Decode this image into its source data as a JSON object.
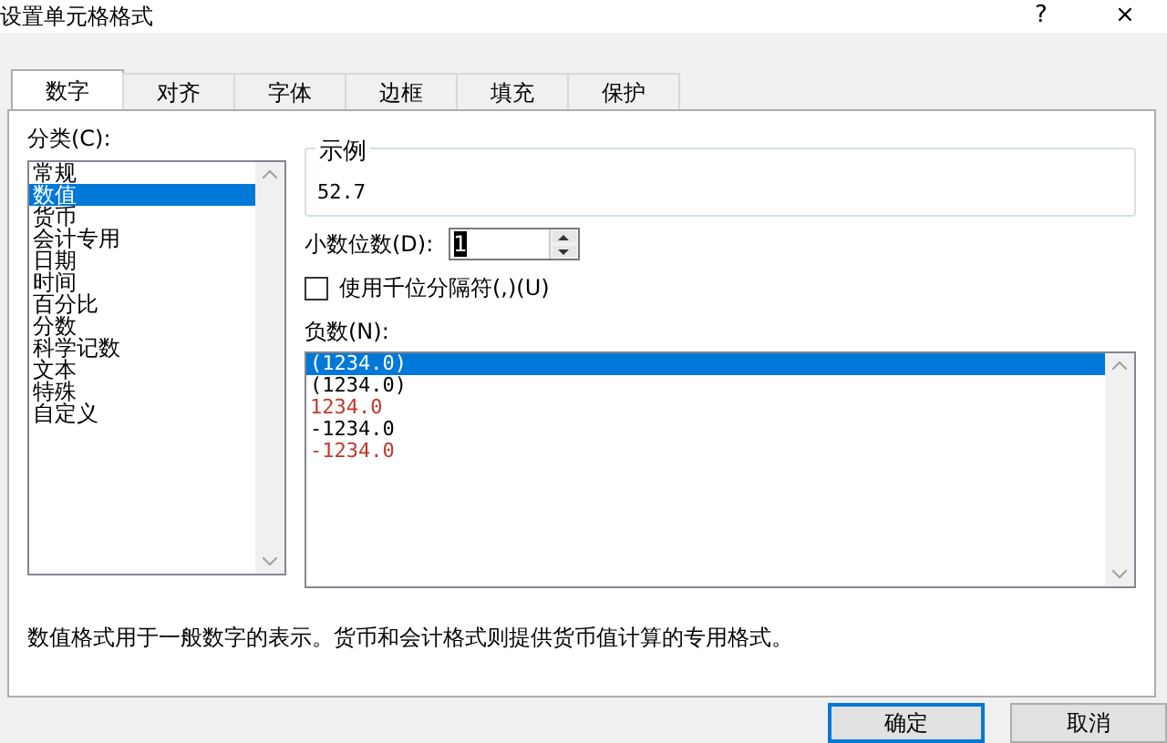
{
  "window": {
    "title": "设置单元格格式",
    "help": "?",
    "close": "×"
  },
  "tabs": [
    {
      "label": "数字",
      "selected": true
    },
    {
      "label": "对齐",
      "selected": false
    },
    {
      "label": "字体",
      "selected": false
    },
    {
      "label": "边框",
      "selected": false
    },
    {
      "label": "填充",
      "selected": false
    },
    {
      "label": "保护",
      "selected": false
    }
  ],
  "category": {
    "label": "分类(C):",
    "items": [
      {
        "label": "常规",
        "selected": false
      },
      {
        "label": "数值",
        "selected": true
      },
      {
        "label": "货币",
        "selected": false
      },
      {
        "label": "会计专用",
        "selected": false
      },
      {
        "label": "日期",
        "selected": false
      },
      {
        "label": "时间",
        "selected": false
      },
      {
        "label": "百分比",
        "selected": false
      },
      {
        "label": "分数",
        "selected": false
      },
      {
        "label": "科学记数",
        "selected": false
      },
      {
        "label": "文本",
        "selected": false
      },
      {
        "label": "特殊",
        "selected": false
      },
      {
        "label": "自定义",
        "selected": false
      }
    ]
  },
  "sample": {
    "label": "示例",
    "value": "52.7"
  },
  "decimal_places": {
    "label": "小数位数(D):",
    "value": "1"
  },
  "thousands_separator": {
    "label": "使用千位分隔符(,)(U)",
    "checked": false
  },
  "negative_numbers": {
    "label": "负数(N):",
    "items": [
      {
        "label": "(1234.0)",
        "selected": true
      },
      {
        "label": "(1234.0)",
        "color": "#000000",
        "selected": false
      },
      {
        "label": "1234.0",
        "color": "#c0392b",
        "selected": false
      },
      {
        "label": "-1234.0",
        "color": "#000000",
        "selected": false
      },
      {
        "label": "-1234.0",
        "color": "#c0392b",
        "selected": false
      }
    ]
  },
  "description": "数值格式用于一般数字的表示。货币和会计格式则提供货币值计算的专用格式。",
  "buttons": [
    {
      "label": "确定",
      "kind": "default"
    },
    {
      "label": "取消",
      "kind": "normal"
    }
  ]
}
